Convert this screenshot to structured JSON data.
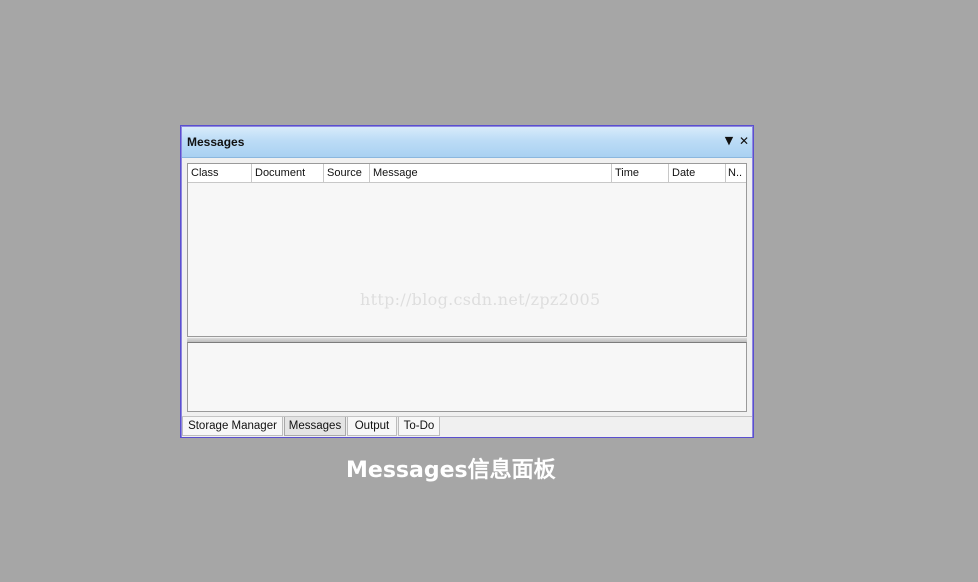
{
  "panel": {
    "title": "Messages",
    "menu_icon": "dropdown-triangle-icon",
    "menu_glyph": "▼",
    "close_icon": "close-icon",
    "close_glyph": "✕",
    "columns": [
      {
        "label": "Class"
      },
      {
        "label": "Document"
      },
      {
        "label": "Source"
      },
      {
        "label": "Message"
      },
      {
        "label": "Time"
      },
      {
        "label": "Date"
      },
      {
        "label": "N.."
      }
    ],
    "watermark": "http://blog.csdn.net/zpz2005",
    "tabs": [
      {
        "label": "Storage Manager",
        "active": false
      },
      {
        "label": "Messages",
        "active": true
      },
      {
        "label": "Output",
        "active": false
      },
      {
        "label": "To-Do",
        "active": false
      }
    ]
  },
  "caption": "Messages信息面板",
  "colors": {
    "background": "#a6a6a6",
    "title_gradient_top": "#d8ebfa",
    "title_gradient_bottom": "#a9d1f2",
    "panel_border": "#5a4fcf",
    "caption_text": "#ffffff"
  }
}
